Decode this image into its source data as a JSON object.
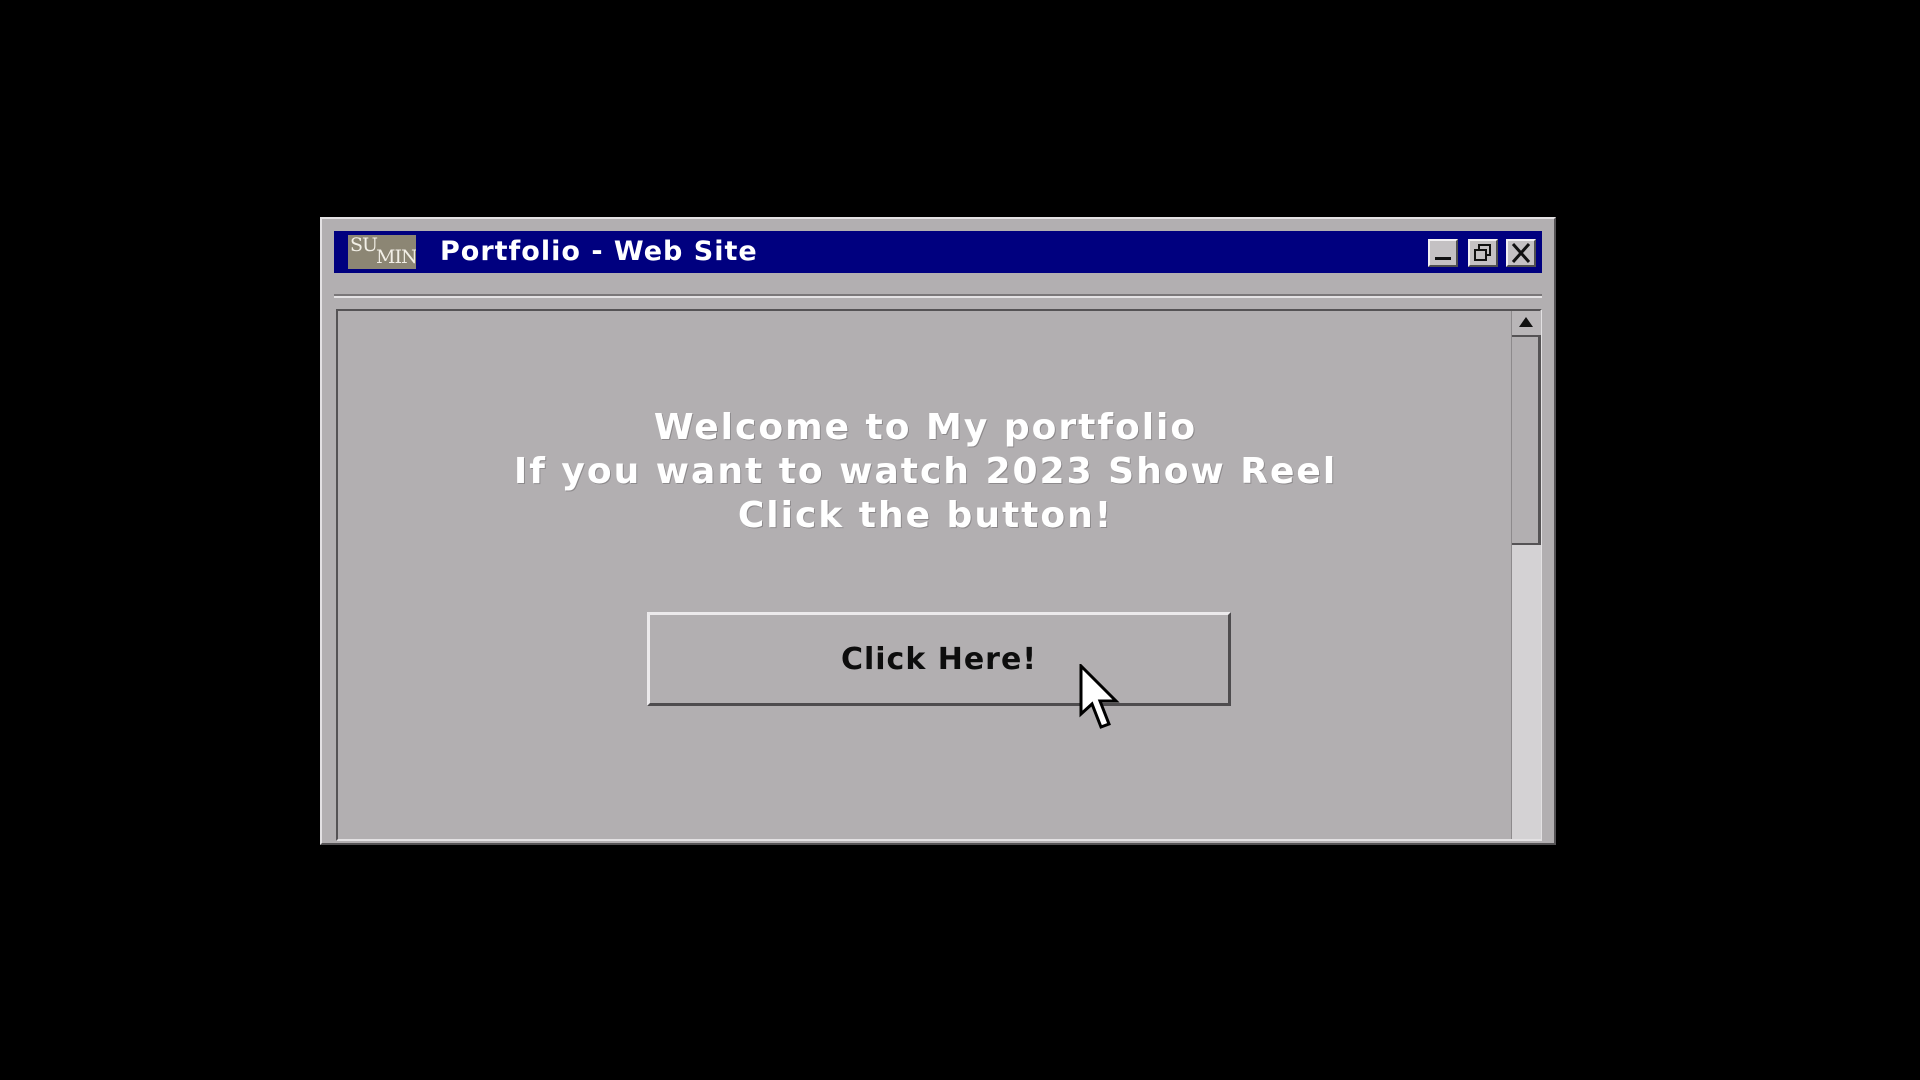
{
  "window": {
    "title": "Portfolio - Web Site",
    "logo": {
      "line1": "SU",
      "line2": "MIN"
    },
    "controls": {
      "minimize": "minimize-icon",
      "restore": "restore-icon",
      "close": "close-icon"
    }
  },
  "content": {
    "welcome_lines": [
      "Welcome to My portfolio",
      "If you want to watch 2023 Show Reel",
      "Click the button!"
    ],
    "button_label": "Click Here!"
  },
  "scrollbar": {
    "up_arrow": "arrow-up-icon"
  },
  "cursor": {
    "icon": "mouse-pointer-icon"
  },
  "colors": {
    "desktop": "#000000",
    "titlebar": "#00007f",
    "window_face": "#b2afb1",
    "logo_bg": "#8c8674"
  }
}
